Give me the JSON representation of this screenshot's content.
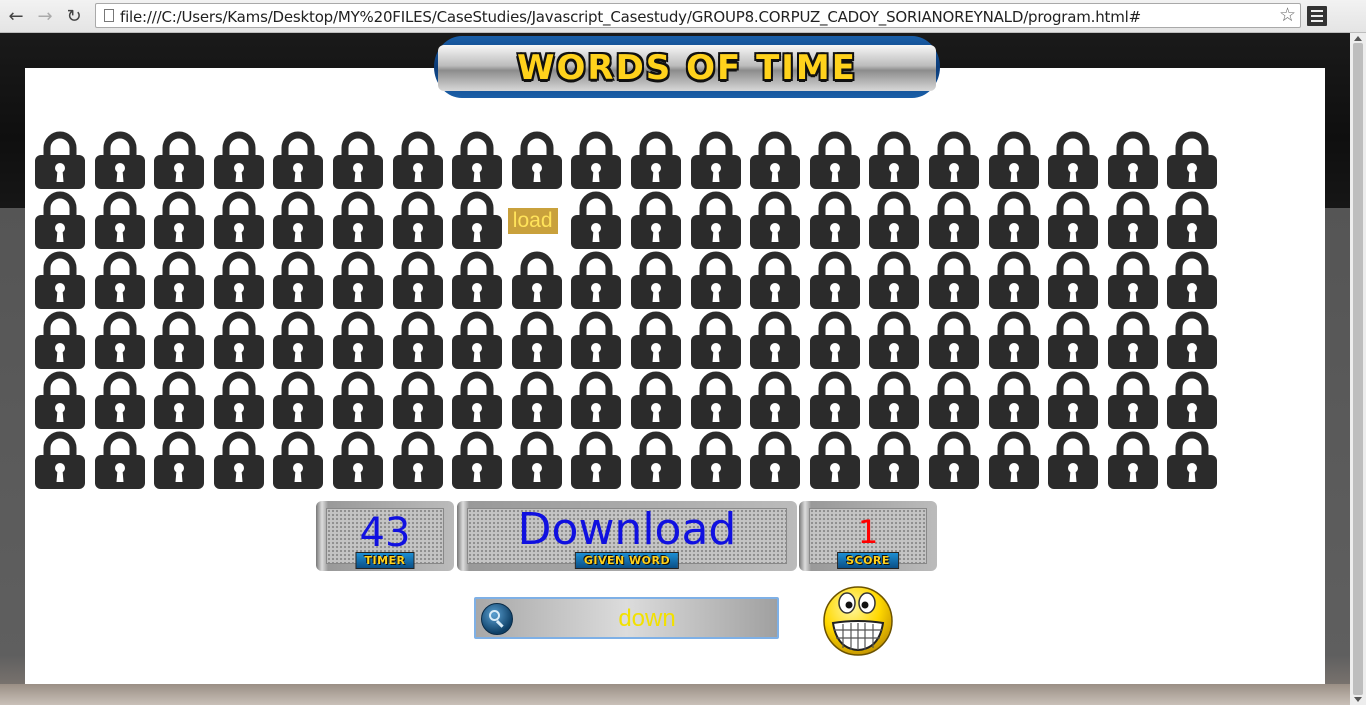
{
  "browser": {
    "url": "file:///C:/Users/Kams/Desktop/MY%20FILES/CaseStudies/Javascript_Casestudy/GROUP8.CORPUZ_CADOY_SORIANOREYNALD/program.html#",
    "back_icon": "arrow-left-icon",
    "forward_icon": "arrow-right-icon",
    "reload_icon": "reload-icon",
    "star_icon": "star-icon",
    "menu_icon": "menu-icon"
  },
  "game": {
    "title": "WORDS OF TIME",
    "grid": {
      "rows": 6,
      "cols": 20,
      "revealed": [
        {
          "row": 1,
          "col": 8,
          "text": "load"
        }
      ]
    },
    "timer": {
      "value": "43",
      "label": "TIMER"
    },
    "given_word": {
      "value": "Download",
      "label": "GIVEN WORD"
    },
    "score": {
      "value": "1",
      "label": "SCORE"
    },
    "answer_input": {
      "value": "down"
    },
    "colors": {
      "title": "#ffd21c",
      "timer_value": "#1010e0",
      "given_word_value": "#1010e0",
      "score_value": "#ff0000",
      "input_text": "#f2e100",
      "lock": "#2b2b2b",
      "revealed_bg": "#c9a13c",
      "revealed_text": "#ffe35a"
    },
    "mascot_icon": "grinning-smiley-icon"
  }
}
